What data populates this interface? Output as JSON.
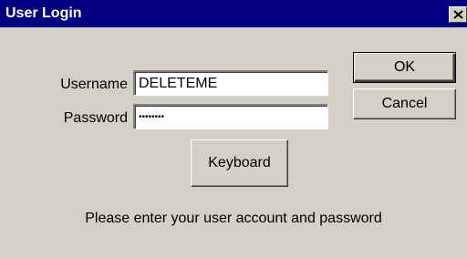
{
  "window": {
    "title": "User Login",
    "close_glyph": "close-icon"
  },
  "form": {
    "username_label": "Username",
    "username_value": "DELETEME",
    "password_label": "Password",
    "password_value": "********"
  },
  "buttons": {
    "ok_label": "OK",
    "cancel_label": "Cancel",
    "keyboard_label": "Keyboard"
  },
  "message": "Please enter your user account and password",
  "colors": {
    "titlebar": "#000080",
    "face": "#d4d0c8"
  }
}
